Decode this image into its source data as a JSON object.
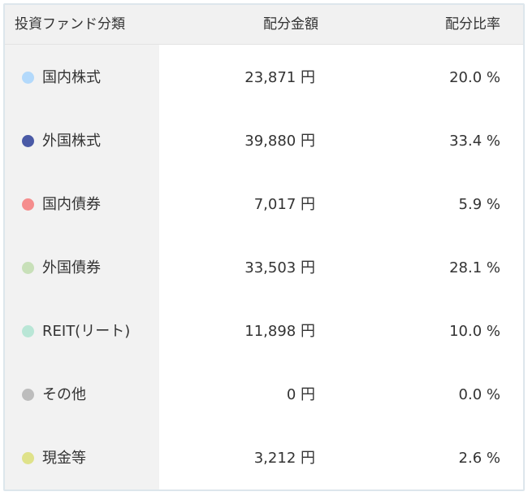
{
  "header": {
    "category_label": "投資ファンド分類",
    "amount_label": "配分金額",
    "ratio_label": "配分比率"
  },
  "rows": [
    {
      "category": "国内株式",
      "amount": "23,871 円",
      "ratio": "20.0 %",
      "color": "#b3d9fb"
    },
    {
      "category": "外国株式",
      "amount": "39,880 円",
      "ratio": "33.4 %",
      "color": "#4a5aa6"
    },
    {
      "category": "国内債券",
      "amount": "7,017 円",
      "ratio": "5.9 %",
      "color": "#f58d8d"
    },
    {
      "category": "外国債券",
      "amount": "33,503 円",
      "ratio": "28.1 %",
      "color": "#c8e0b9"
    },
    {
      "category": "REIT(リート)",
      "amount": "11,898 円",
      "ratio": "10.0 %",
      "color": "#b9e6d6"
    },
    {
      "category": "その他",
      "amount": "0 円",
      "ratio": "0.0 %",
      "color": "#bdbdbd"
    },
    {
      "category": "現金等",
      "amount": "3,212 円",
      "ratio": "2.6 %",
      "color": "#dfe28a"
    }
  ]
}
